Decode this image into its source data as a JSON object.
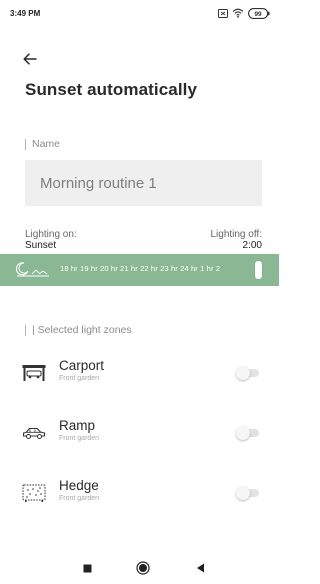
{
  "status_bar": {
    "time": "3:49 PM",
    "icons": [
      "sim-card-icon",
      "wifi-icon",
      "battery-icon"
    ],
    "battery": "99"
  },
  "header": {
    "back_icon": "arrow-left-icon",
    "title": "Sunset automatically"
  },
  "name_section": {
    "label": "Name",
    "value": "Morning routine 1"
  },
  "lighting": {
    "on_label": "Lighting on:",
    "on_value": "Sunset",
    "off_label": "Lighting off:",
    "off_value": "2:00"
  },
  "timeline": {
    "icon": "sunset-icon",
    "hours_text": "18 hr 19 hr 20 hr 21 hr 22 hr 23 hr 24 hr 1 hr  2",
    "color": "#8ab894"
  },
  "zones_section": {
    "label": "| Selected light zones"
  },
  "zones": [
    {
      "name": "Carport",
      "subtitle": "Front garden",
      "icon": "carport-icon",
      "enabled": false
    },
    {
      "name": "Ramp",
      "subtitle": "Front garden",
      "icon": "car-icon",
      "enabled": false
    },
    {
      "name": "Hedge",
      "subtitle": "Front garden",
      "icon": "hedge-icon",
      "enabled": false
    }
  ],
  "nav_bar": {
    "buttons": [
      "recents-square-icon",
      "home-circle-icon",
      "back-triangle-icon"
    ]
  }
}
